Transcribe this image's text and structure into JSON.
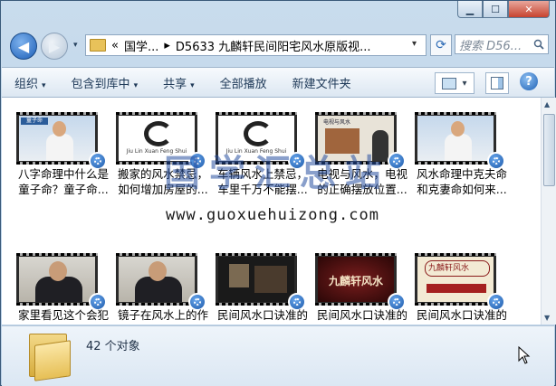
{
  "window": {
    "caption": {
      "minimize": "▁",
      "maximize": "☐",
      "close": "✕"
    }
  },
  "nav": {
    "back_label": "◀",
    "forward_label": "▶",
    "dropdown": "▾",
    "address": {
      "prefix": "«",
      "crumbs": [
        "国学...",
        "D5633 九麟轩民间阳宅风水原版视..."
      ],
      "separator": "▸",
      "tail": "▾"
    },
    "refresh": "⟳",
    "search_placeholder": "搜索 D56...",
    "search_icon": "search-icon"
  },
  "toolbar": {
    "items": [
      {
        "label": "组织",
        "arrow": "▾"
      },
      {
        "label": "包含到库中",
        "arrow": "▾"
      },
      {
        "label": "共享",
        "arrow": "▾"
      },
      {
        "label": "全部播放",
        "arrow": ""
      },
      {
        "label": "新建文件夹",
        "arrow": ""
      }
    ],
    "view_arrow": "▾",
    "help": "?"
  },
  "files": [
    {
      "label_line1": "八字命理中什么是",
      "label_line2": "童子命？童子命...",
      "thumb": "person",
      "banner": "童子命"
    },
    {
      "label_line1": "搬家的风水禁忌，",
      "label_line2": "如何增加房屋的...",
      "thumb": "logo",
      "logo_text": "Jiu Lin Xuan Feng Shui"
    },
    {
      "label_line1": "车辆风水上禁忌，",
      "label_line2": "车里千万不能摆...",
      "thumb": "logo",
      "logo_text": "Jiu Lin Xuan Feng Shui"
    },
    {
      "label_line1": "电视与风水，电视",
      "label_line2": "的正确摆放位置...",
      "thumb": "slide",
      "slide_title": "电视与风水"
    },
    {
      "label_line1": "风水命理中克夫命",
      "label_line2": "和克妻命如何来...",
      "thumb": "person2"
    },
    {
      "label_line1": "家里看见这个会犯",
      "label_line2": "",
      "thumb": "suit"
    },
    {
      "label_line1": "镜子在风水上的作",
      "label_line2": "",
      "thumb": "suit"
    },
    {
      "label_line1": "民间风水口诀准的",
      "label_line2": "",
      "thumb": "dark"
    },
    {
      "label_line1": "民间风水口诀准的",
      "label_line2": "",
      "thumb": "red",
      "slide_title": "九麟轩风水"
    },
    {
      "label_line1": "民间风水口诀准的",
      "label_line2": "",
      "thumb": "cream",
      "slide_title": "九麟轩风水"
    }
  ],
  "watermark": {
    "text": "国学汇总站",
    "url": "www.guoxuehuizong.com"
  },
  "details": {
    "count": "42 个对象"
  },
  "colors": {
    "accent": "#1d5fb7",
    "toolbar_text": "#1e3958"
  }
}
